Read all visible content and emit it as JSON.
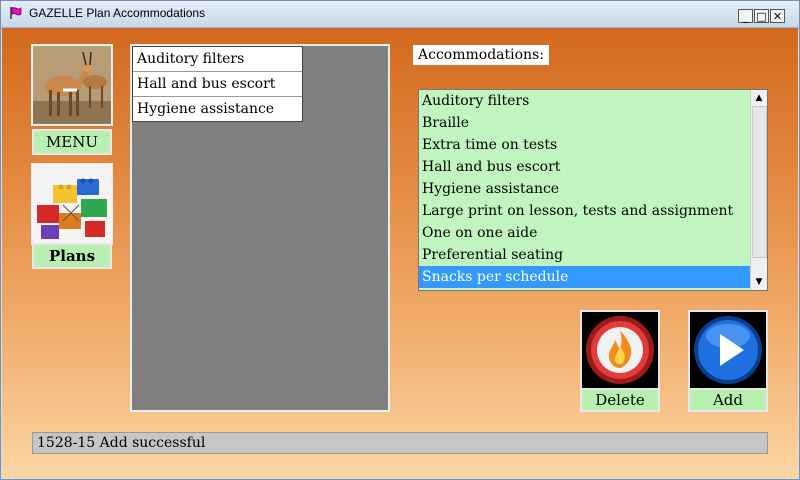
{
  "window": {
    "title": "GAZELLE Plan Accommodations",
    "controls": {
      "minimize": "_",
      "maximize": "□",
      "close": "✕"
    }
  },
  "nav": {
    "menu_label": "MENU",
    "plans_label": "Plans"
  },
  "selected_accommodations": [
    "Auditory filters",
    "Hall and bus escort",
    "Hygiene assistance"
  ],
  "accommodations": {
    "label": "Accommodations:",
    "items": [
      "Auditory filters",
      "Braille",
      "Extra time on tests",
      "Hall and bus escort",
      "Hygiene assistance",
      "Large print  on lesson, tests and assignment",
      "One on one aide",
      "Preferential seating",
      "Snacks per schedule"
    ],
    "selected_index": 8
  },
  "actions": {
    "delete_label": "Delete",
    "add_label": "Add"
  },
  "status": {
    "text": "1528-15 Add successful"
  },
  "colors": {
    "list_bg": "#c0f5c0",
    "selection": "#3399ff",
    "button_label_bg": "#b7f0b0"
  }
}
